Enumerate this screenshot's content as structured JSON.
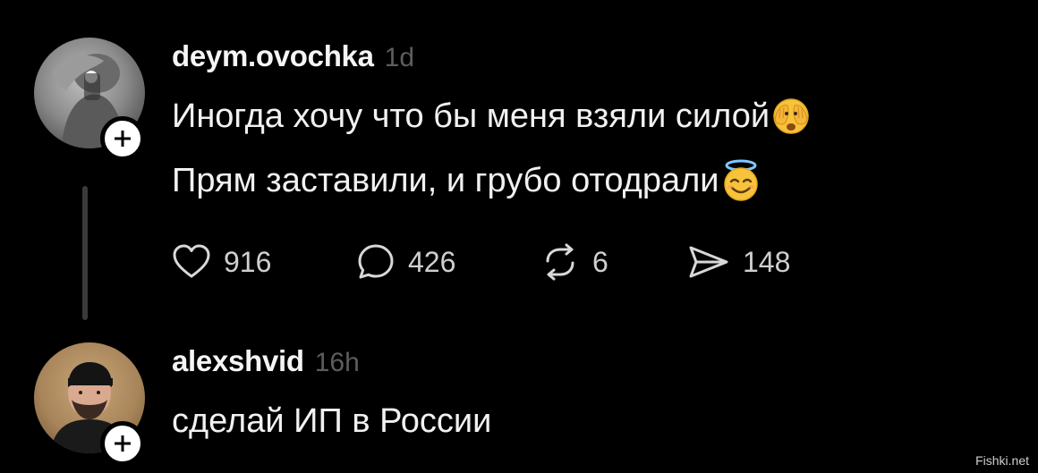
{
  "posts": [
    {
      "username": "deym.ovochka",
      "time": "1d",
      "lines": [
        "Иногда хочу что бы меня взяли силой",
        "Прям заставили, и грубо отодрали"
      ],
      "emojis": [
        "face-with-hands-over-eyes-icon",
        "smiling-face-with-halo-icon"
      ],
      "actions": {
        "likes": "916",
        "comments": "426",
        "reposts": "6",
        "shares": "148"
      }
    },
    {
      "username": "alexshvid",
      "time": "16h",
      "lines": [
        "сделай ИП в России"
      ]
    }
  ],
  "watermark": "Fishki.net",
  "colors": {
    "background": "#000000",
    "text": "#f1f1f1",
    "muted": "#5d5d5d",
    "badge": "#ffffff",
    "thread_line": "#3a3a3a"
  }
}
